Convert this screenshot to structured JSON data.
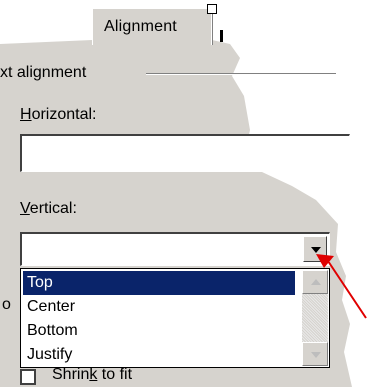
{
  "tab": {
    "label": "Alignment"
  },
  "group": {
    "label": "xt alignment"
  },
  "horizontal": {
    "label_accel": "H",
    "label_rest": "orizontal:",
    "value": ""
  },
  "vertical": {
    "label_accel": "V",
    "label_rest": "ertical:",
    "value": "",
    "options": [
      "Top",
      "Center",
      "Bottom",
      "Justify"
    ],
    "selected": "Top"
  },
  "shrink": {
    "label_pre": "Shrin",
    "label_accel": "k",
    "label_rest": " to fit"
  },
  "cut_letter": "o",
  "colors": {
    "selection": "#0a246a",
    "dialog": "#d6d3ce",
    "arrow": "#e00000"
  }
}
